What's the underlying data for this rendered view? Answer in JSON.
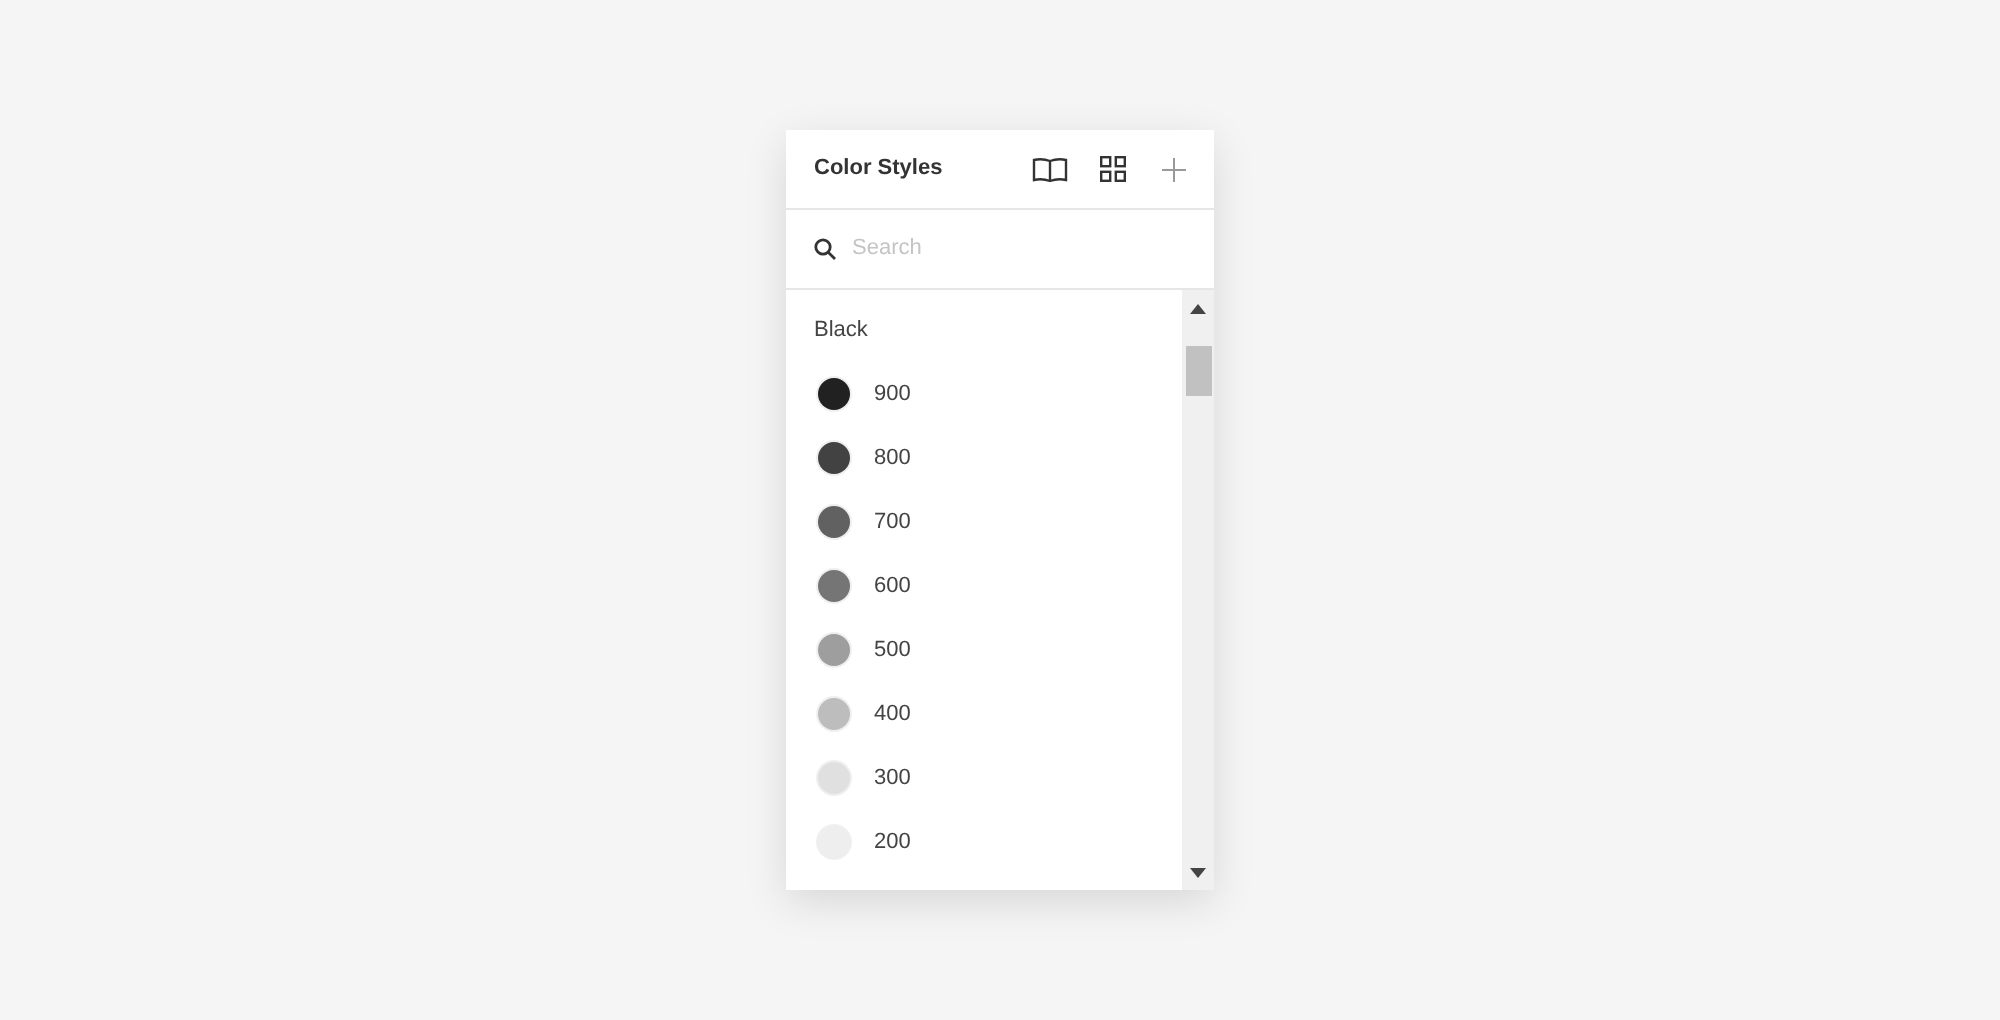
{
  "panel": {
    "title": "Color Styles"
  },
  "search": {
    "placeholder": "Search"
  },
  "groups": [
    {
      "label": "Black",
      "styles": [
        {
          "name": "900",
          "color": "#212121"
        },
        {
          "name": "800",
          "color": "#424242"
        },
        {
          "name": "700",
          "color": "#616161"
        },
        {
          "name": "600",
          "color": "#757575"
        },
        {
          "name": "500",
          "color": "#9e9e9e"
        },
        {
          "name": "400",
          "color": "#bdbdbd"
        },
        {
          "name": "300",
          "color": "#e0e0e0"
        },
        {
          "name": "200",
          "color": "#eeeeee"
        }
      ]
    }
  ]
}
